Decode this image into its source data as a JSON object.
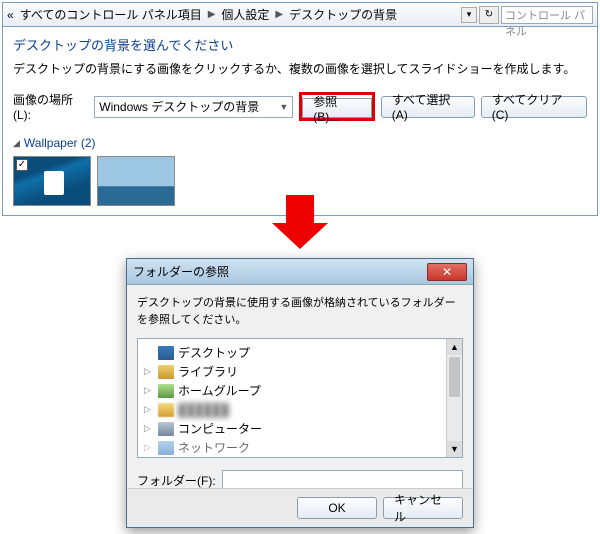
{
  "breadcrumb": {
    "b0": "«",
    "b1": "すべてのコントロール パネル項目",
    "b2": "個人設定",
    "b3": "デスクトップの背景"
  },
  "searchPlaceholder": "コントロール パネル",
  "page": {
    "title": "デスクトップの背景を選んでください",
    "desc": "デスクトップの背景にする画像をクリックするか、複数の画像を選択してスライドショーを作成します。",
    "locLabel": "画像の場所(L):",
    "locValue": "Windows デスクトップの背景",
    "browse": "参照(B)...",
    "selectAll": "すべて選択(A)",
    "clearAll": "すべてクリア(C)"
  },
  "category": {
    "name": "Wallpaper (2)"
  },
  "dialog": {
    "title": "フォルダーの参照",
    "text": "デスクトップの背景に使用する画像が格納されているフォルダーを参照してください。",
    "items": {
      "desktop": "デスクトップ",
      "libraries": "ライブラリ",
      "homegroup": "ホームグループ",
      "user": "██████",
      "computer": "コンピューター",
      "network": "ネットワーク"
    },
    "folderLabel": "フォルダー(F):",
    "ok": "OK",
    "cancel": "キャンセル"
  }
}
